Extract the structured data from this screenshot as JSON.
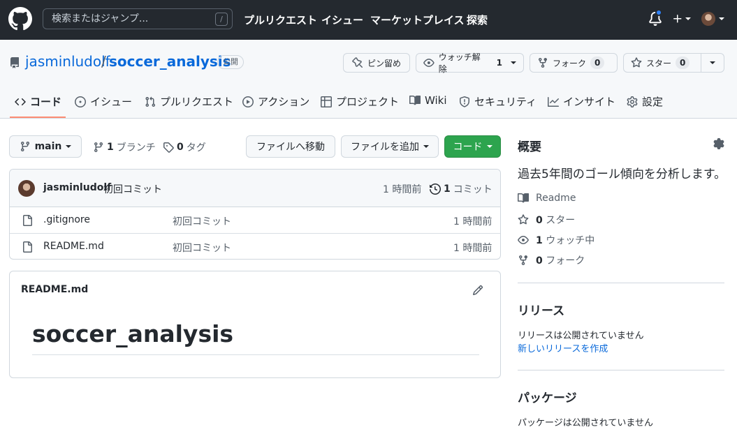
{
  "header": {
    "search_placeholder": "検索またはジャンプ...",
    "search_shortcut": "/",
    "nav": [
      "プルリクエスト",
      "イシュー",
      "マーケットプレイス",
      "探索"
    ]
  },
  "repo": {
    "owner": "jasminludolf",
    "separator": "/",
    "name": "soccer_analysis",
    "visibility": "公開",
    "pin_label": "ピン留め",
    "watch_label": "ウォッチ解除",
    "watch_count": "1",
    "fork_label": "フォーク",
    "fork_count": "0",
    "star_label": "スター",
    "star_count": "0"
  },
  "tabs": [
    {
      "label": "コード",
      "icon": "code-icon"
    },
    {
      "label": "イシュー",
      "icon": "issue-icon"
    },
    {
      "label": "プルリクエスト",
      "icon": "pull-request-icon"
    },
    {
      "label": "アクション",
      "icon": "play-icon"
    },
    {
      "label": "プロジェクト",
      "icon": "table-icon"
    },
    {
      "label": "Wiki",
      "icon": "book-icon"
    },
    {
      "label": "セキュリティ",
      "icon": "shield-icon"
    },
    {
      "label": "インサイト",
      "icon": "graph-icon"
    },
    {
      "label": "設定",
      "icon": "gear-icon"
    }
  ],
  "toolbar": {
    "branch": "main",
    "branch_count": "1",
    "branch_label": "ブランチ",
    "tag_count": "0",
    "tag_label": "タグ",
    "goto_file": "ファイルへ移動",
    "add_file": "ファイルを追加",
    "code": "コード"
  },
  "commit": {
    "author": "jasminludolf",
    "message": "初回コミット",
    "time": "1 時間前",
    "count": "1",
    "count_label": "コミット"
  },
  "files": [
    {
      "name": ".gitignore",
      "message": "初回コミット",
      "time": "1 時間前"
    },
    {
      "name": "README.md",
      "message": "初回コミット",
      "time": "1 時間前"
    }
  ],
  "readme": {
    "filename": "README.md",
    "heading": "soccer_analysis"
  },
  "sidebar": {
    "about_title": "概要",
    "description": "過去5年間のゴール傾向を分析します。",
    "readme_label": "Readme",
    "stars_count": "0",
    "stars_label": "スター",
    "watching_count": "1",
    "watching_label": "ウォッチ中",
    "forks_count": "0",
    "forks_label": "フォーク",
    "releases_title": "リリース",
    "releases_text": "リリースは公開されていません",
    "releases_link": "新しいリリースを作成",
    "packages_title": "パッケージ",
    "packages_text": "パッケージは公開されていません"
  }
}
